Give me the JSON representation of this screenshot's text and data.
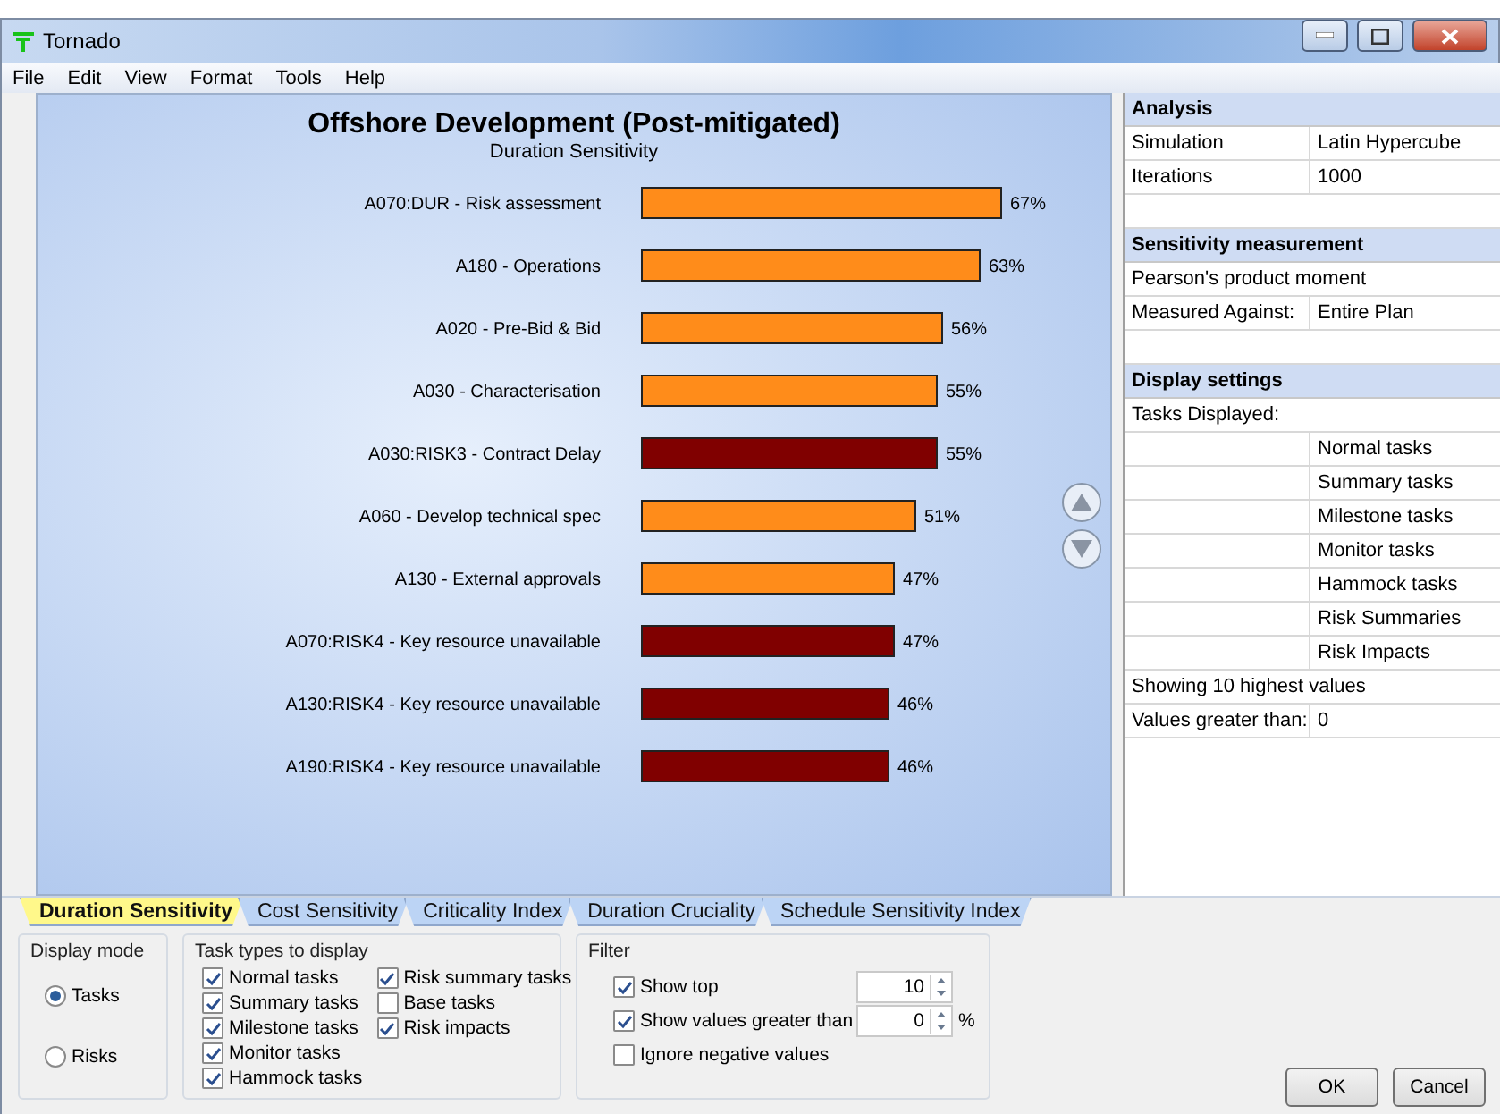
{
  "window": {
    "title": "Tornado"
  },
  "menu": [
    "File",
    "Edit",
    "View",
    "Format",
    "Tools",
    "Help"
  ],
  "chart": {
    "title": "Offshore Development (Post-mitigated)",
    "subtitle": "Duration Sensitivity",
    "chart_data": {
      "type": "bar",
      "orientation": "horizontal",
      "categories": [
        "A070:DUR - Risk assessment",
        "A180 - Operations",
        "A020 - Pre-Bid & Bid",
        "A030 - Characterisation",
        "A030:RISK3 - Contract Delay",
        "A060 - Develop technical spec",
        "A130 - External approvals",
        "A070:RISK4 - Key resource unavailable",
        "A130:RISK4 - Key resource unavailable",
        "A190:RISK4 - Key resource unavailable"
      ],
      "series": [
        {
          "color": "#ff8c1a",
          "values": [
            67,
            63,
            56,
            55,
            null,
            51,
            47,
            null,
            null,
            null
          ],
          "value_labels": [
            "67%",
            "63%",
            "56%",
            "55%",
            null,
            "51%",
            "47%",
            null,
            null,
            null
          ]
        },
        {
          "color": "#800000",
          "values": [
            null,
            null,
            null,
            null,
            55,
            null,
            null,
            47,
            46,
            46
          ],
          "value_labels": [
            null,
            null,
            null,
            null,
            "55%",
            null,
            null,
            "47%",
            "46%",
            "46%"
          ]
        }
      ]
    }
  },
  "side_panel": [
    {
      "title": "Analysis",
      "rows": [
        {
          "kind": "pair",
          "label": "Simulation",
          "value": "Latin Hypercube"
        },
        {
          "kind": "pair",
          "label": "Iterations",
          "value": "1000"
        }
      ]
    },
    {
      "title": "Sensitivity measurement",
      "rows": [
        {
          "kind": "full",
          "label": "Pearson's product moment"
        },
        {
          "kind": "pair",
          "label": "Measured Against:",
          "value": "Entire Plan"
        }
      ]
    },
    {
      "title": "Display settings",
      "rows": [
        {
          "kind": "full",
          "label": "Tasks Displayed:"
        },
        {
          "kind": "value",
          "value": "Normal tasks"
        },
        {
          "kind": "value",
          "value": "Summary tasks"
        },
        {
          "kind": "value",
          "value": "Milestone tasks"
        },
        {
          "kind": "value",
          "value": "Monitor tasks"
        },
        {
          "kind": "value",
          "value": "Hammock tasks"
        },
        {
          "kind": "value",
          "value": "Risk Summaries"
        },
        {
          "kind": "value",
          "value": "Risk Impacts"
        },
        {
          "kind": "full",
          "label": "Showing 10 highest values"
        },
        {
          "kind": "pair",
          "label": "Values greater than:",
          "value": "0"
        }
      ]
    }
  ],
  "tabs": [
    {
      "label": "Duration Sensitivity",
      "selected": true
    },
    {
      "label": "Cost Sensitivity",
      "selected": false
    },
    {
      "label": "Criticality Index",
      "selected": false
    },
    {
      "label": "Duration Cruciality",
      "selected": false
    },
    {
      "label": "Schedule Sensitivity Index",
      "selected": false
    }
  ],
  "display_mode": {
    "title": "Display mode",
    "options": [
      {
        "label": "Tasks",
        "selected": true
      },
      {
        "label": "Risks",
        "selected": false
      }
    ]
  },
  "task_types": {
    "title": "Task types to display",
    "columns": [
      [
        {
          "label": "Normal tasks",
          "checked": true
        },
        {
          "label": "Summary tasks",
          "checked": true
        },
        {
          "label": "Milestone tasks",
          "checked": true
        },
        {
          "label": "Monitor tasks",
          "checked": true
        },
        {
          "label": "Hammock tasks",
          "checked": true
        }
      ],
      [
        {
          "label": "Risk summary tasks",
          "checked": true
        },
        {
          "label": "Base tasks",
          "checked": false
        },
        {
          "label": "Risk impacts",
          "checked": true
        }
      ]
    ]
  },
  "filter": {
    "title": "Filter",
    "rows": [
      {
        "kind": "spinner",
        "label": "Show top",
        "checked": true,
        "value": "10"
      },
      {
        "kind": "spinner",
        "label": "Show values greater than",
        "checked": true,
        "value": "0",
        "unit": "%"
      },
      {
        "kind": "plain",
        "label": "Ignore negative values",
        "checked": false
      }
    ]
  },
  "buttons": [
    "OK",
    "Cancel"
  ]
}
